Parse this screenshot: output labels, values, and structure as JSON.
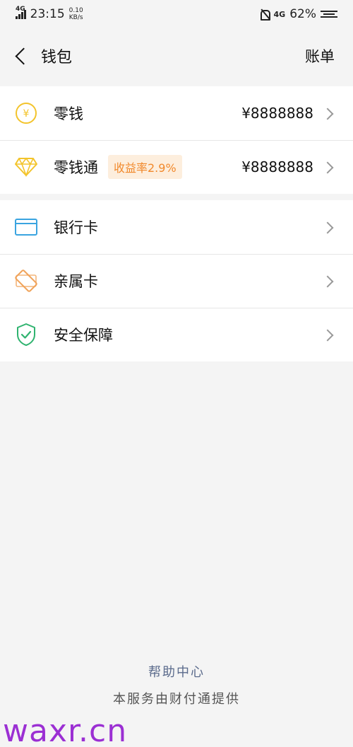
{
  "status_bar": {
    "network": "4G",
    "time": "23:15",
    "speed_value": "0.10",
    "speed_unit": "KB/s",
    "network_right": "4G",
    "battery": "62%"
  },
  "nav": {
    "title": "钱包",
    "right_label": "账单"
  },
  "group1": [
    {
      "label": "零钱",
      "value": "¥8888888",
      "icon": "yuan-coin-icon"
    },
    {
      "label": "零钱通",
      "badge": "收益率2.9%",
      "value": "¥8888888",
      "icon": "diamond-icon"
    }
  ],
  "group2": [
    {
      "label": "银行卡",
      "icon": "bank-card-icon"
    },
    {
      "label": "亲属卡",
      "icon": "family-card-icon"
    },
    {
      "label": "安全保障",
      "icon": "shield-check-icon"
    }
  ],
  "footer": {
    "help": "帮助中心",
    "provider": "本服务由财付通提供"
  },
  "watermark": "waxr.cn",
  "colors": {
    "coin": "#f3c42c",
    "diamond": "#f3c42c",
    "bank": "#3aa4e0",
    "family": "#f0a35a",
    "shield": "#2fb36f",
    "badge_bg": "#fdeedd",
    "badge_text": "#f1892c",
    "help_link": "#5b6b8c"
  }
}
